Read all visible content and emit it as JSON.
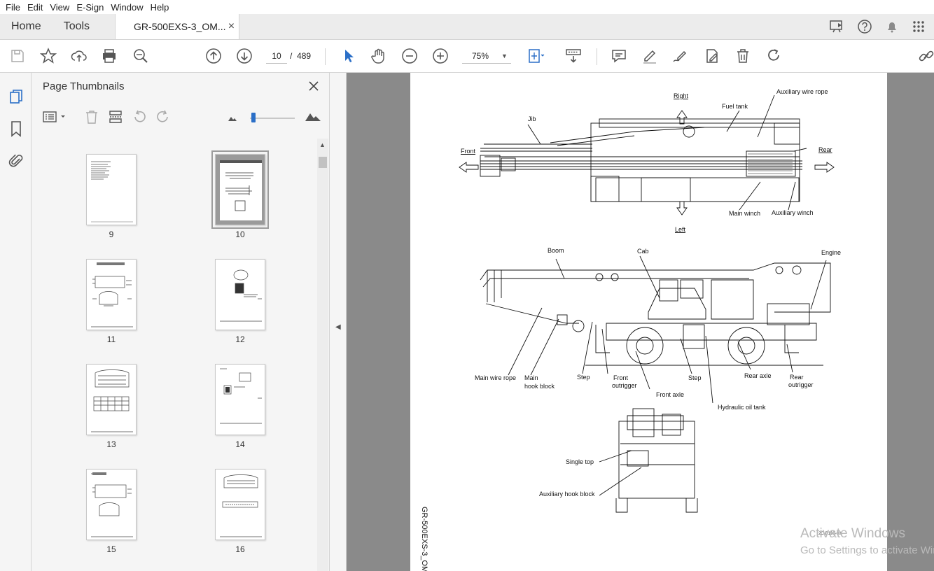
{
  "menu": [
    "File",
    "Edit",
    "View",
    "E-Sign",
    "Window",
    "Help"
  ],
  "tabs": {
    "home": "Home",
    "tools": "Tools",
    "document": "GR-500EXS-3_OM...",
    "close": "×"
  },
  "toolbar": {
    "current_page": "10",
    "page_sep": "/",
    "total_pages": "489",
    "zoom": "75%"
  },
  "panel": {
    "title": "Page Thumbnails",
    "thumbnails": [
      {
        "label": "9"
      },
      {
        "label": "10"
      },
      {
        "label": "11"
      },
      {
        "label": "12"
      },
      {
        "label": "13"
      },
      {
        "label": "14"
      },
      {
        "label": "15"
      },
      {
        "label": "16"
      }
    ]
  },
  "page": {
    "labels": {
      "right": "Right",
      "auxiliary_wire_rope": "Auxiliary wire rope",
      "fuel_tank": "Fuel tank",
      "jib": "Jib",
      "front": "Front",
      "rear": "Rear",
      "main_winch": "Main winch",
      "auxiliary_winch": "Auxiliary winch",
      "left": "Left",
      "boom": "Boom",
      "cab": "Cab",
      "engine": "Engine",
      "main_wire_rope": "Main wire rope",
      "main_hook_block_1": "Main",
      "main_hook_block_2": "hook block",
      "step_1": "Step",
      "front_outrigger_1": "Front",
      "front_outrigger_2": "outrigger",
      "step_2": "Step",
      "rear_axle": "Rear axle",
      "rear_outrigger_1": "Rear",
      "rear_outrigger_2": "outrigger",
      "front_axle": "Front axle",
      "hydraulic_oil_tank": "Hydraulic oil tank",
      "single_top": "Single top",
      "auxiliary_hook_block": "Auxiliary hook block",
      "figure_code": "2C-B160-00",
      "side_text": "GR-500EXS-3_OM"
    }
  },
  "watermark": {
    "line1": "Activate Windows",
    "line2": "Go to Settings to activate Windows."
  },
  "colors": {
    "accent": "#2b6fc7",
    "doc_background": "#8a8a8a",
    "panel_background": "#f5f5f5"
  }
}
